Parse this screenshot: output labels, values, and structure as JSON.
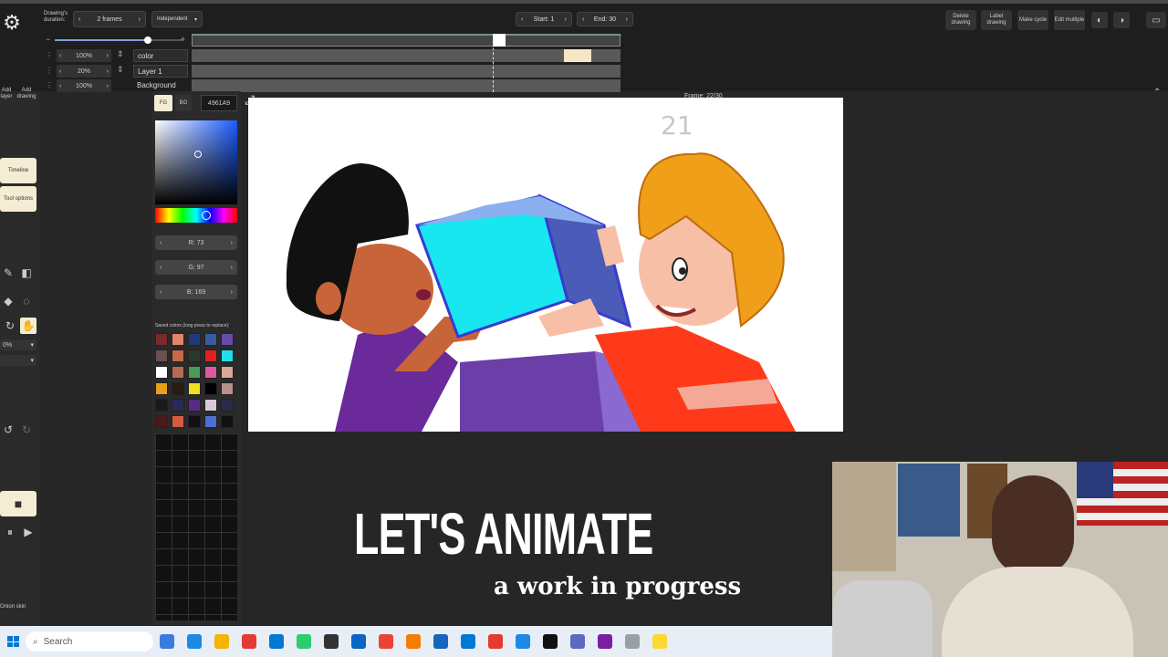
{
  "toolbar": {
    "duration_label": "Drawing's duration:",
    "duration_value": "2 frames",
    "mode_value": "Independent",
    "start_label": "Start: 1",
    "end_label": "End: 30",
    "buttons": [
      "Delete drawing",
      "Label drawing",
      "Make cycle",
      "Edit multiple"
    ]
  },
  "layers": [
    {
      "opacity": "100%",
      "name": "color"
    },
    {
      "opacity": "20%",
      "name": "Layer 1"
    },
    {
      "opacity": "100%",
      "name": "Background"
    }
  ],
  "frame_indicator": "Frame: 22/30",
  "left_buttons": {
    "add_layer": "Add layer",
    "add_drawing": "Add drawing",
    "timeline": "Timeline",
    "tool_options": "Tool options",
    "zoom": "0%",
    "onion_skin": "Onion skin"
  },
  "color_panel": {
    "fg_label": "FG",
    "bg_label": "BG",
    "hex_value": "4961A9",
    "r": "R: 73",
    "g": "G: 97",
    "b": "B: 169",
    "saved_label": "Saved colors (long press to replace):",
    "saved_colors": [
      "#7a2a2a",
      "#e0846a",
      "#1e3a7a",
      "#3a5aa0",
      "#6a4aa8",
      "#6a5050",
      "#c66a48",
      "#2a3a2a",
      "#e02020",
      "#20e0ee",
      "#ffffff",
      "#b86a50",
      "#4a9a5a",
      "#e058a0",
      "#d8a898",
      "#e8a018",
      "#2a1a10",
      "#f0e020",
      "#000000",
      "#b89088",
      "#1a1a1a",
      "#2a2a5a",
      "#5a2a8a",
      "#d8c8d8",
      "#2a2a4a",
      "#4a1a1a",
      "#d85a40",
      "#111111",
      "#4a70d8",
      "#111111"
    ]
  },
  "canvas": {
    "frame_sketch": "21"
  },
  "overlay": {
    "title": "LET'S ANIMATE",
    "subtitle": "a work in progress"
  },
  "taskbar": {
    "search_placeholder": "Search",
    "icon_colors": [
      "#3b7be0",
      "#1e88e5",
      "#f4b400",
      "#e53935",
      "#0078d4",
      "#2ecc71",
      "#333333",
      "#0a66c2",
      "#ea4335",
      "#f57c00",
      "#1565c0",
      "#0078d7",
      "#e53935",
      "#1e88e5",
      "#111111",
      "#5c6bc0",
      "#7b1fa2",
      "#9aa0a6",
      "#fdd835"
    ]
  }
}
